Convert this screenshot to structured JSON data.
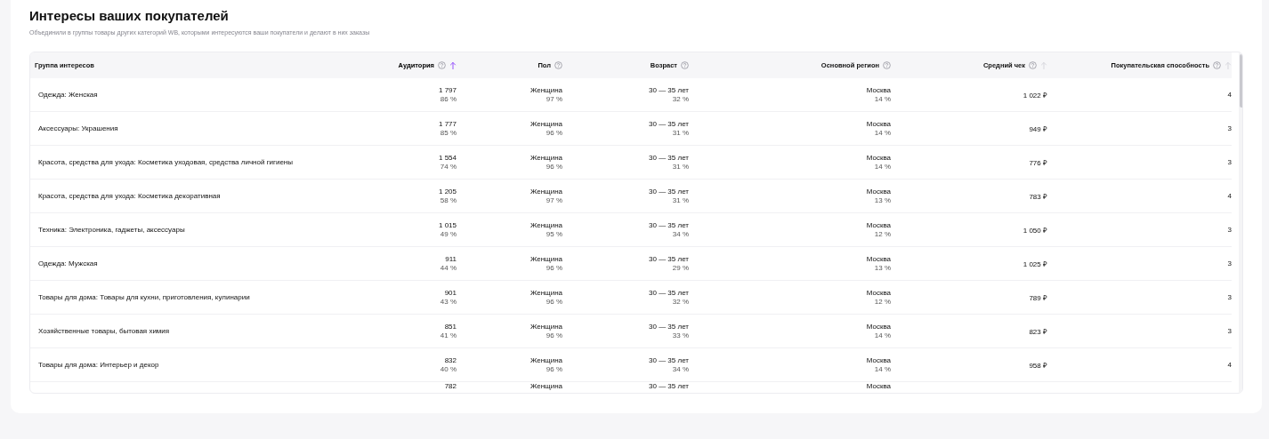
{
  "title": "Интересы ваших покупателей",
  "subtitle": "Объединили в группы товары других категорий WB, которыми интересуются ваши покупатели и делают в них заказы",
  "columns": [
    {
      "label": "Группа интересов",
      "help": false,
      "sortable": false,
      "selected": false
    },
    {
      "label": "Аудитория",
      "help": true,
      "sortable": true,
      "selected": true
    },
    {
      "label": "Пол",
      "help": true,
      "sortable": false,
      "selected": false
    },
    {
      "label": "Возраст",
      "help": true,
      "sortable": false,
      "selected": false
    },
    {
      "label": "Основной регион",
      "help": true,
      "sortable": false,
      "selected": false
    },
    {
      "label": "Средний чек",
      "help": true,
      "sortable": true,
      "selected": false
    },
    {
      "label": "Покупательская способность",
      "help": true,
      "sortable": true,
      "selected": false
    }
  ],
  "rows": [
    {
      "group": "Одежда: Женская",
      "audience": "1 797",
      "audience_share": "86 %",
      "gender": "Женщина",
      "gender_share": "97 %",
      "age": "30 — 35 лет",
      "age_share": "32 %",
      "region": "Москва",
      "region_share": "14 %",
      "check": "1 022 ₽",
      "power": "4"
    },
    {
      "group": "Аксессуары: Украшения",
      "audience": "1 777",
      "audience_share": "85 %",
      "gender": "Женщина",
      "gender_share": "96 %",
      "age": "30 — 35 лет",
      "age_share": "31 %",
      "region": "Москва",
      "region_share": "14 %",
      "check": "949 ₽",
      "power": "3"
    },
    {
      "group": "Красота, средства для ухода: Косметика уходовая, средства личной гигиены",
      "audience": "1 554",
      "audience_share": "74 %",
      "gender": "Женщина",
      "gender_share": "96 %",
      "age": "30 — 35 лет",
      "age_share": "31 %",
      "region": "Москва",
      "region_share": "14 %",
      "check": "776 ₽",
      "power": "3"
    },
    {
      "group": "Красота, средства для ухода: Косметика декоративная",
      "audience": "1 205",
      "audience_share": "58 %",
      "gender": "Женщина",
      "gender_share": "97 %",
      "age": "30 — 35 лет",
      "age_share": "31 %",
      "region": "Москва",
      "region_share": "13 %",
      "check": "783 ₽",
      "power": "4"
    },
    {
      "group": "Техника: Электроника, гаджеты, аксессуары",
      "audience": "1 015",
      "audience_share": "49 %",
      "gender": "Женщина",
      "gender_share": "95 %",
      "age": "30 — 35 лет",
      "age_share": "34 %",
      "region": "Москва",
      "region_share": "12 %",
      "check": "1 050 ₽",
      "power": "3"
    },
    {
      "group": "Одежда: Мужская",
      "audience": "911",
      "audience_share": "44 %",
      "gender": "Женщина",
      "gender_share": "96 %",
      "age": "30 — 35 лет",
      "age_share": "29 %",
      "region": "Москва",
      "region_share": "13 %",
      "check": "1 025 ₽",
      "power": "3"
    },
    {
      "group": "Товары для дома: Товары для кухни, приготовления, кулинарии",
      "audience": "901",
      "audience_share": "43 %",
      "gender": "Женщина",
      "gender_share": "96 %",
      "age": "30 — 35 лет",
      "age_share": "32 %",
      "region": "Москва",
      "region_share": "12 %",
      "check": "789 ₽",
      "power": "3"
    },
    {
      "group": "Хозяйственные товары, бытовая химия",
      "audience": "851",
      "audience_share": "41 %",
      "gender": "Женщина",
      "gender_share": "96 %",
      "age": "30 — 35 лет",
      "age_share": "33 %",
      "region": "Москва",
      "region_share": "14 %",
      "check": "823 ₽",
      "power": "3"
    },
    {
      "group": "Товары для дома: Интерьер и декор",
      "audience": "832",
      "audience_share": "40 %",
      "gender": "Женщина",
      "gender_share": "96 %",
      "age": "30 — 35 лет",
      "age_share": "34 %",
      "region": "Москва",
      "region_share": "14 %",
      "check": "958 ₽",
      "power": "4"
    },
    {
      "audience": "782",
      "gender": "Женщина",
      "age": "30 — 35 лет",
      "region": "Москва"
    }
  ]
}
